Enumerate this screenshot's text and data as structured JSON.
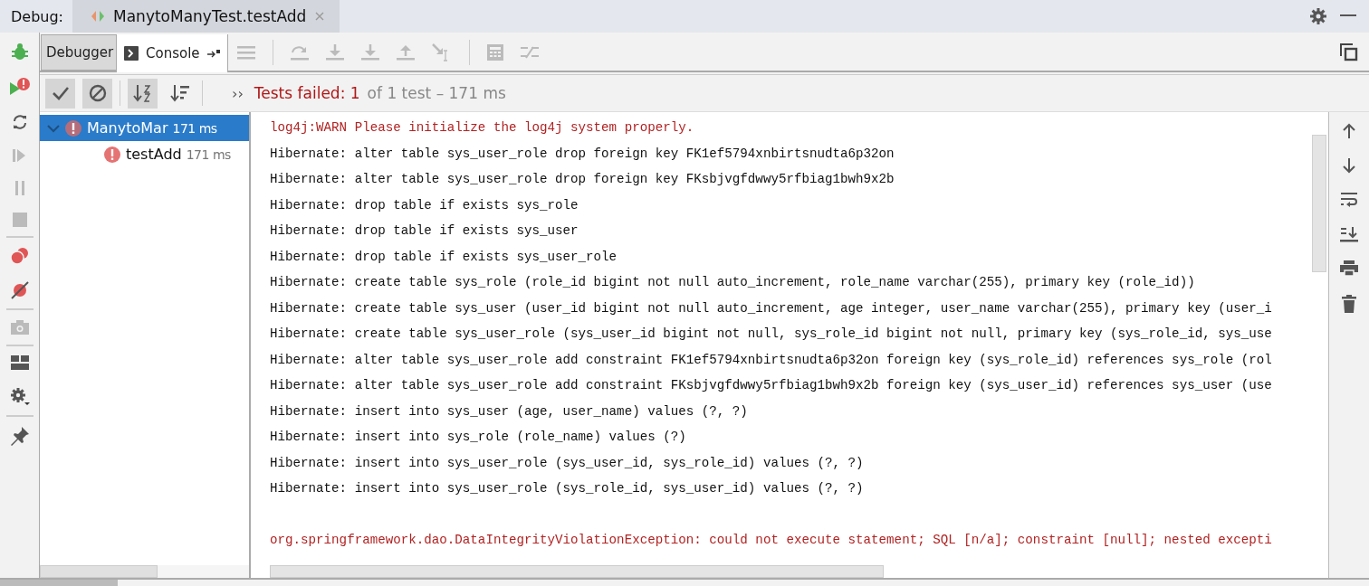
{
  "header": {
    "label": "Debug:",
    "session_tab": "ManytoManyTest.testAdd"
  },
  "tabs": [
    {
      "label": "Debugger",
      "selected": false
    },
    {
      "label": "Console",
      "selected": true
    }
  ],
  "test_toolbar": {
    "toggles": [
      {
        "on": true
      },
      {
        "on": true
      },
      {
        "on": true
      },
      {
        "on": false
      }
    ],
    "expand": "››",
    "status": "Tests failed: 1",
    "summary": "of 1 test – 171 ms"
  },
  "tree": [
    {
      "name": "ManytoMar",
      "time": "171 ms",
      "failed": true,
      "selected": true,
      "expanded": true,
      "children": [
        {
          "name": "testAdd",
          "time": "171 ms",
          "failed": true,
          "selected": false
        }
      ]
    }
  ],
  "console_lines": [
    {
      "kind": "warn",
      "text": "log4j:WARN Please initialize the log4j system properly."
    },
    {
      "kind": "info",
      "text": "Hibernate: alter table sys_user_role drop foreign key FK1ef5794xnbirtsnudta6p32on"
    },
    {
      "kind": "info",
      "text": "Hibernate: alter table sys_user_role drop foreign key FKsbjvgfdwwy5rfbiag1bwh9x2b"
    },
    {
      "kind": "info",
      "text": "Hibernate: drop table if exists sys_role"
    },
    {
      "kind": "info",
      "text": "Hibernate: drop table if exists sys_user"
    },
    {
      "kind": "info",
      "text": "Hibernate: drop table if exists sys_user_role"
    },
    {
      "kind": "info",
      "text": "Hibernate: create table sys_role (role_id bigint not null auto_increment, role_name varchar(255), primary key (role_id))"
    },
    {
      "kind": "info",
      "text": "Hibernate: create table sys_user (user_id bigint not null auto_increment, age integer, user_name varchar(255), primary key (user_i"
    },
    {
      "kind": "info",
      "text": "Hibernate: create table sys_user_role (sys_user_id bigint not null, sys_role_id bigint not null, primary key (sys_role_id, sys_use"
    },
    {
      "kind": "info",
      "text": "Hibernate: alter table sys_user_role add constraint FK1ef5794xnbirtsnudta6p32on foreign key (sys_role_id) references sys_role (rol"
    },
    {
      "kind": "info",
      "text": "Hibernate: alter table sys_user_role add constraint FKsbjvgfdwwy5rfbiag1bwh9x2b foreign key (sys_user_id) references sys_user (use"
    },
    {
      "kind": "info",
      "text": "Hibernate: insert into sys_user (age, user_name) values (?, ?)"
    },
    {
      "kind": "info",
      "text": "Hibernate: insert into sys_role (role_name) values (?)"
    },
    {
      "kind": "info",
      "text": "Hibernate: insert into sys_user_role (sys_user_id, sys_role_id) values (?, ?)"
    },
    {
      "kind": "info",
      "text": "Hibernate: insert into sys_user_role (sys_role_id, sys_user_id) values (?, ?)"
    },
    {
      "kind": "error",
      "text": "org.springframework.dao.DataIntegrityViolationException: could not execute statement; SQL [n/a]; constraint [null]; nested excepti"
    }
  ]
}
